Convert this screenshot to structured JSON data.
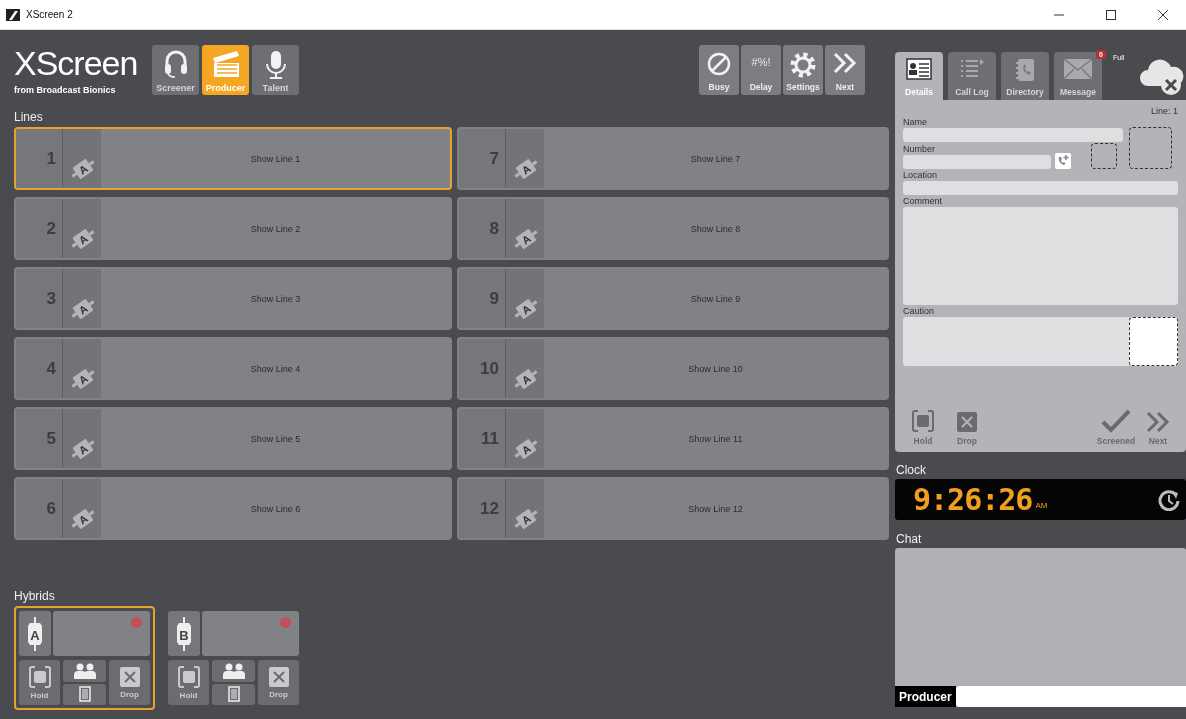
{
  "window": {
    "title": "XScreen 2"
  },
  "logo": {
    "name": "XScreen",
    "tagline": "from Broadcast Bionics"
  },
  "modes": [
    {
      "label": "Screener",
      "kind": "headset",
      "selected": false
    },
    {
      "label": "Producer",
      "kind": "clapper",
      "selected": true
    },
    {
      "label": "Talent",
      "kind": "mic",
      "selected": false
    }
  ],
  "tools": [
    {
      "label": "Busy",
      "kind": "busy"
    },
    {
      "label": "Delay",
      "kind": "delay",
      "glyph": "#%!"
    },
    {
      "label": "Settings",
      "kind": "gear"
    },
    {
      "label": "Next",
      "kind": "next"
    }
  ],
  "lines_title": "Lines",
  "lines": [
    {
      "number": "1",
      "label": "Show Line 1",
      "plug": "A",
      "selected": true
    },
    {
      "number": "2",
      "label": "Show Line 2",
      "plug": "A",
      "selected": false
    },
    {
      "number": "3",
      "label": "Show Line 3",
      "plug": "A",
      "selected": false
    },
    {
      "number": "4",
      "label": "Show Line 4",
      "plug": "A",
      "selected": false
    },
    {
      "number": "5",
      "label": "Show Line 5",
      "plug": "A",
      "selected": false
    },
    {
      "number": "6",
      "label": "Show Line 6",
      "plug": "A",
      "selected": false
    },
    {
      "number": "7",
      "label": "Show Line 7",
      "plug": "A",
      "selected": false
    },
    {
      "number": "8",
      "label": "Show Line 8",
      "plug": "A",
      "selected": false
    },
    {
      "number": "9",
      "label": "Show Line 9",
      "plug": "A",
      "selected": false
    },
    {
      "number": "10",
      "label": "Show Line 10",
      "plug": "A",
      "selected": false
    },
    {
      "number": "11",
      "label": "Show Line 11",
      "plug": "A",
      "selected": false
    },
    {
      "number": "12",
      "label": "Show Line 12",
      "plug": "A",
      "selected": false
    }
  ],
  "hybrids_title": "Hybrids",
  "hybrids": [
    {
      "letter": "A",
      "selected": true,
      "hold": "Hold",
      "drop": "Drop",
      "disabled": true
    },
    {
      "letter": "B",
      "selected": false,
      "hold": "Hold",
      "drop": "Drop",
      "disabled": true
    }
  ],
  "panel": {
    "tabs": [
      {
        "label": "Details",
        "kind": "details",
        "selected": true
      },
      {
        "label": "Call Log",
        "kind": "calllog",
        "selected": false
      },
      {
        "label": "Directory",
        "kind": "directory",
        "selected": false
      },
      {
        "label": "Message",
        "kind": "message",
        "selected": false,
        "badge": "0"
      }
    ],
    "status": "Full",
    "line": "Line: 1",
    "fields": [
      {
        "label": "Name",
        "kind": "name"
      },
      {
        "label": "Number",
        "kind": "number"
      },
      {
        "label": "Location",
        "kind": "location"
      },
      {
        "label": "Comment",
        "kind": "comment"
      },
      {
        "label": "Caution",
        "kind": "caution"
      }
    ],
    "actions": [
      {
        "label": "Hold",
        "kind": "hold",
        "disabled": true
      },
      {
        "label": "Drop",
        "kind": "drop",
        "disabled": true
      },
      {
        "label": "Screened",
        "kind": "screened",
        "disabled": true
      },
      {
        "label": "Next",
        "kind": "next",
        "disabled": true
      }
    ]
  },
  "clock": {
    "title": "Clock",
    "time": "9:26:26",
    "ampm": "AM"
  },
  "chat": {
    "title": "Chat",
    "sender": "Producer"
  }
}
